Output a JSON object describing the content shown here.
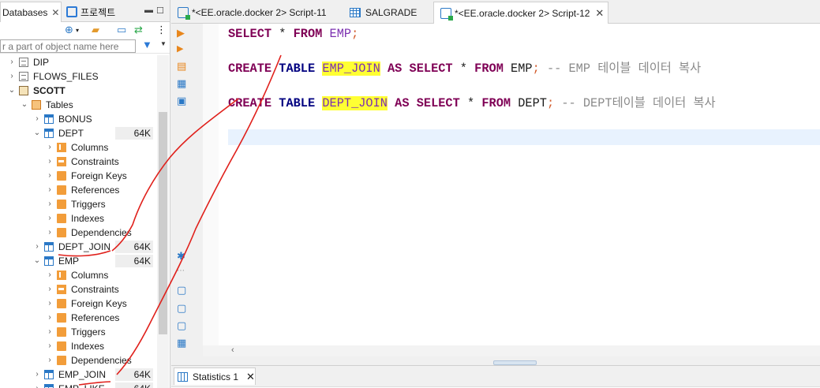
{
  "left_panel": {
    "tabs": [
      {
        "label": "Databases",
        "active": true
      },
      {
        "label": "프로젝트",
        "active": false
      }
    ],
    "filter_placeholder": "r a part of object name here",
    "tree": [
      {
        "label": "DIP",
        "type": "db",
        "indent": 0,
        "arrow": "›"
      },
      {
        "label": "FLOWS_FILES",
        "type": "db",
        "indent": 0,
        "arrow": "›"
      },
      {
        "label": "SCOTT",
        "type": "schema",
        "indent": 0,
        "arrow": "⌄",
        "bold": true
      },
      {
        "label": "Tables",
        "type": "tables",
        "indent": 1,
        "arrow": "⌄"
      },
      {
        "label": "BONUS",
        "type": "table",
        "indent": 2,
        "arrow": "›"
      },
      {
        "label": "DEPT",
        "type": "table",
        "indent": 2,
        "arrow": "⌄",
        "size": "64K"
      },
      {
        "label": "Columns",
        "type": "cols",
        "indent": 3,
        "arrow": "›"
      },
      {
        "label": "Constraints",
        "type": "cons",
        "indent": 3,
        "arrow": "›"
      },
      {
        "label": "Foreign Keys",
        "type": "folder",
        "indent": 3,
        "arrow": "›"
      },
      {
        "label": "References",
        "type": "folder",
        "indent": 3,
        "arrow": "›"
      },
      {
        "label": "Triggers",
        "type": "folder",
        "indent": 3,
        "arrow": "›"
      },
      {
        "label": "Indexes",
        "type": "folder",
        "indent": 3,
        "arrow": "›"
      },
      {
        "label": "Dependencies",
        "type": "folder",
        "indent": 3,
        "arrow": "›"
      },
      {
        "label": "DEPT_JOIN",
        "type": "table",
        "indent": 2,
        "arrow": "›",
        "size": "64K"
      },
      {
        "label": "EMP",
        "type": "table",
        "indent": 2,
        "arrow": "⌄",
        "size": "64K"
      },
      {
        "label": "Columns",
        "type": "cols",
        "indent": 3,
        "arrow": "›"
      },
      {
        "label": "Constraints",
        "type": "cons",
        "indent": 3,
        "arrow": "›"
      },
      {
        "label": "Foreign Keys",
        "type": "folder",
        "indent": 3,
        "arrow": "›"
      },
      {
        "label": "References",
        "type": "folder",
        "indent": 3,
        "arrow": "›"
      },
      {
        "label": "Triggers",
        "type": "folder",
        "indent": 3,
        "arrow": "›"
      },
      {
        "label": "Indexes",
        "type": "folder",
        "indent": 3,
        "arrow": "›"
      },
      {
        "label": "Dependencies",
        "type": "folder",
        "indent": 3,
        "arrow": "›"
      },
      {
        "label": "EMP_JOIN",
        "type": "table",
        "indent": 2,
        "arrow": "›",
        "size": "64K"
      },
      {
        "label": "EMP_LIKE",
        "type": "table",
        "indent": 2,
        "arrow": "›",
        "size": "64K"
      }
    ]
  },
  "editor": {
    "tabs": [
      {
        "label": "*<EE.oracle.docker 2> Script-11",
        "active": false
      },
      {
        "label": "SALGRADE",
        "active": false
      },
      {
        "label": "*<EE.oracle.docker 2> Script-12",
        "active": true
      }
    ],
    "line1": {
      "kw1": "SELECT",
      "op": " * ",
      "kw2": "FROM",
      "id": " EMP",
      "semi": ";"
    },
    "line2": {
      "kw1": "CREATE",
      "kw2": "TABLE",
      "id": "EMP_JOIN",
      "kw3": "AS",
      "kw4": "SELECT",
      "op": " * ",
      "kw5": "FROM",
      "id2": " EMP",
      "semi": ";",
      "comment": " -- EMP 테이블 데이터 복사"
    },
    "line3": {
      "kw1": "CREATE",
      "kw2": "TABLE",
      "id": "DEPT_JOIN",
      "kw3": "AS",
      "kw4": "SELECT",
      "op": " * ",
      "kw5": "FROM",
      "id2": " DEPT",
      "semi": ";",
      "comment": " -- DEPT테이블 데이터 복사"
    }
  },
  "bottom_panel": {
    "tab_label": "Statistics 1"
  },
  "colors": {
    "keyword": "#7f0055",
    "keyword_blue": "#000080",
    "identifier": "#7b2fb0",
    "highlight": "#ffff33",
    "annotation": "#e0201b"
  }
}
